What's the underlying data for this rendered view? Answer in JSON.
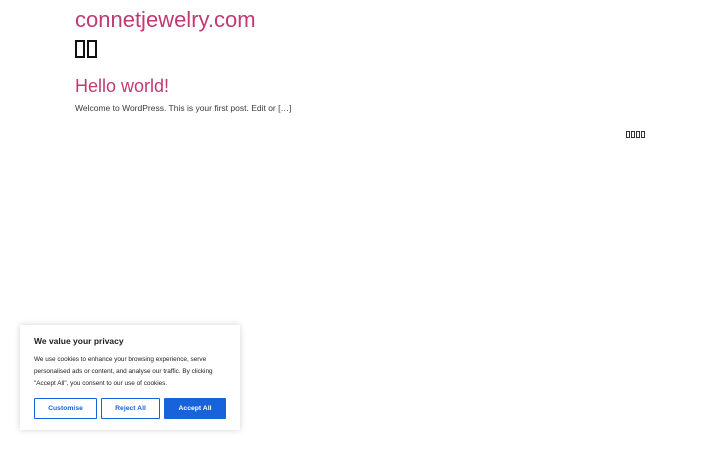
{
  "site": {
    "title": "connetjewelry.com"
  },
  "post": {
    "title": "Hello world!",
    "excerpt": "Welcome to WordPress. This is your first post. Edit or […]"
  },
  "cookie_banner": {
    "title": "We value your privacy",
    "text": "We use cookies to enhance your browsing experience, serve personalised ads or content, and analyse our traffic. By clicking \"Accept All\", you consent to our use of cookies.",
    "customise_label": "Customise",
    "reject_label": "Reject All",
    "accept_label": "Accept All"
  },
  "colors": {
    "accent": "#c13a72",
    "button_blue": "#1863dc"
  }
}
